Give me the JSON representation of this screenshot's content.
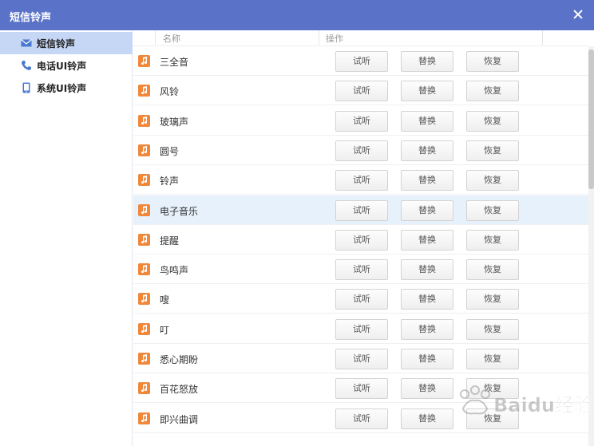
{
  "window": {
    "title": "短信铃声"
  },
  "sidebar": {
    "items": [
      {
        "label": "短信铃声",
        "icon": "envelope-icon",
        "active": true
      },
      {
        "label": "电话UI铃声",
        "icon": "phone-icon",
        "active": false
      },
      {
        "label": "系统UI铃声",
        "icon": "mobile-icon",
        "active": false
      }
    ]
  },
  "table": {
    "headers": {
      "name": "名称",
      "action": "操作"
    },
    "actions": {
      "preview": "试听",
      "replace": "替换",
      "restore": "恢复"
    },
    "rows": [
      {
        "name": "三全音"
      },
      {
        "name": "风铃"
      },
      {
        "name": "玻璃声"
      },
      {
        "name": "圆号"
      },
      {
        "name": "铃声"
      },
      {
        "name": "电子音乐",
        "highlighted": true
      },
      {
        "name": "提醒"
      },
      {
        "name": "鸟鸣声"
      },
      {
        "name": "嗖"
      },
      {
        "name": "叮"
      },
      {
        "name": "悉心期盼"
      },
      {
        "name": "百花怒放"
      },
      {
        "name": "即兴曲调"
      }
    ]
  },
  "watermark": {
    "logo_text": "Baidu经验"
  },
  "colors": {
    "titlebar": "#5a73c9",
    "sidebar_active": "#c5d7f5",
    "row_highlight": "#e6f1fb",
    "note_icon": "#f0883c",
    "side_icon": "#4a78d0"
  }
}
